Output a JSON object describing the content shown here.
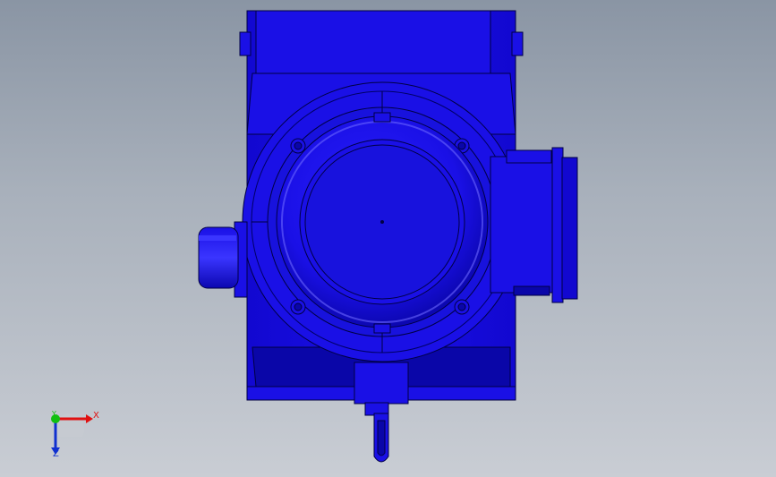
{
  "viewport": {
    "background_top": "#8a95a4",
    "background_bottom": "#c9cdd4"
  },
  "model": {
    "base_color": "#1a10e6",
    "dark_color": "#0a06a8",
    "edge_color": "#000044",
    "highlight_color": "#6b66ff"
  },
  "triad": {
    "x_label": "X",
    "y_label": "Y",
    "z_label": "Z",
    "x_color": "#e01010",
    "y_color": "#10c010",
    "z_color": "#1030d0"
  }
}
